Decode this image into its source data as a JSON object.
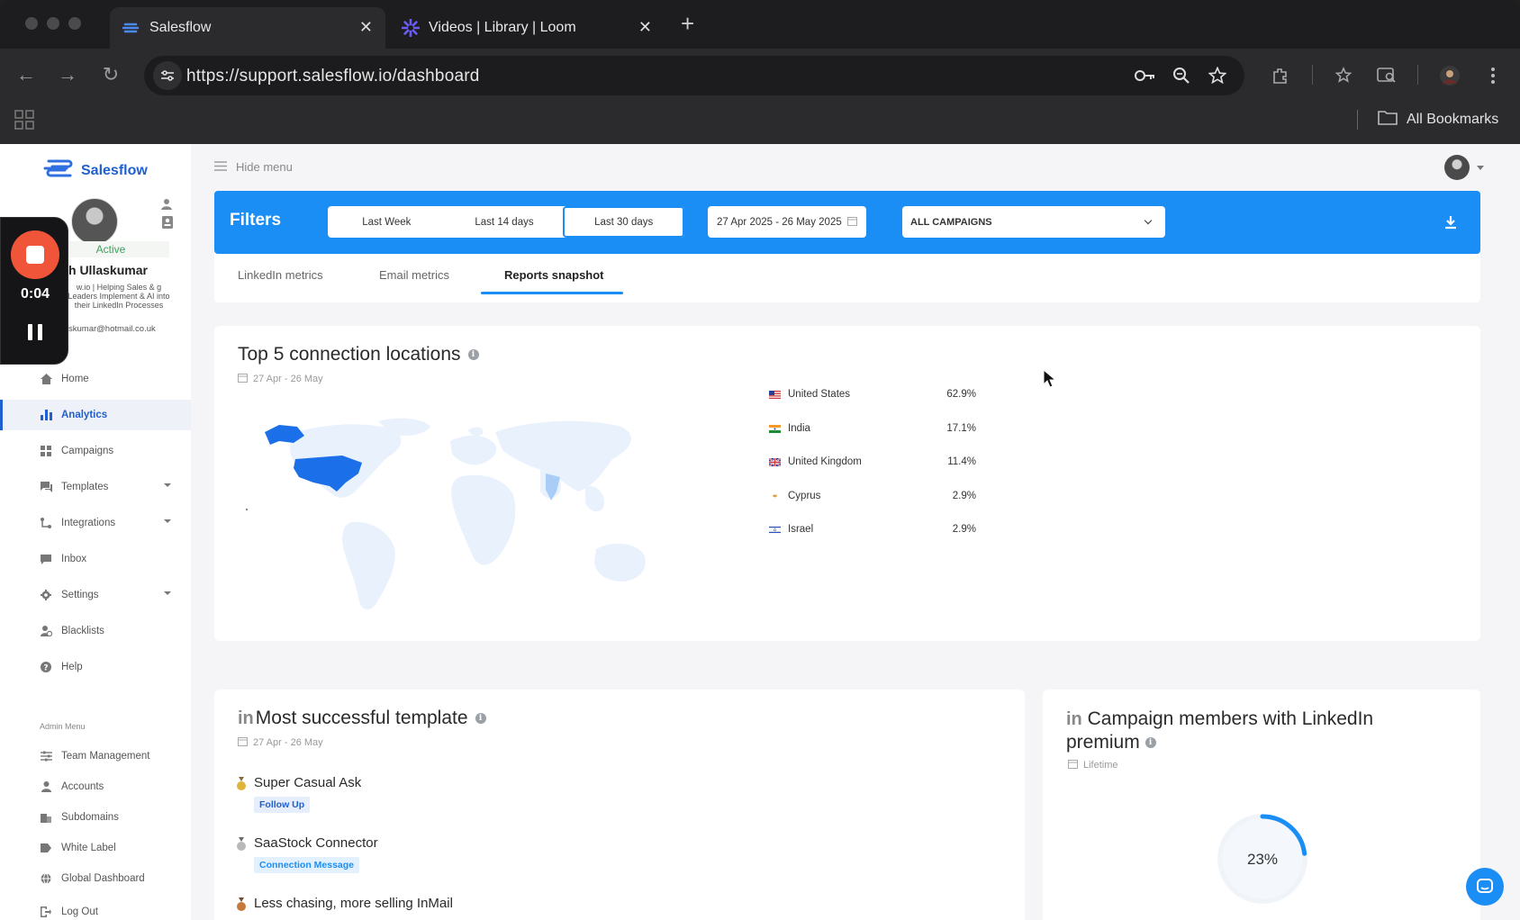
{
  "browser": {
    "tabs": [
      {
        "title": "Salesflow",
        "active": true
      },
      {
        "title": "Videos | Library | Loom",
        "active": false
      }
    ],
    "url": "https://support.salesflow.io/dashboard",
    "bookmarks_label": "All Bookmarks"
  },
  "recorder": {
    "time": "0:04"
  },
  "brand": {
    "name": "Salesflow",
    "accent": "#1b8ef5"
  },
  "profile": {
    "status": "Active",
    "name": "h Ullaskumar",
    "description": "w.io | Helping Sales & g Leaders Implement & AI into their LinkedIn Processes",
    "email": "skumar@hotmail.co.uk"
  },
  "nav": {
    "items": [
      {
        "label": "Home",
        "icon": "home-icon"
      },
      {
        "label": "Analytics",
        "icon": "bar-chart-icon"
      },
      {
        "label": "Campaigns",
        "icon": "grid-icon"
      },
      {
        "label": "Templates",
        "icon": "chat-icon"
      },
      {
        "label": "Integrations",
        "icon": "flow-icon"
      },
      {
        "label": "Inbox",
        "icon": "inbox-icon"
      },
      {
        "label": "Settings",
        "icon": "gear-icon"
      },
      {
        "label": "Blacklists",
        "icon": "user-block-icon"
      },
      {
        "label": "Help",
        "icon": "help-icon"
      }
    ],
    "admin_label": "Admin Menu",
    "admin_items": [
      {
        "label": "Team Management",
        "icon": "sliders-icon"
      },
      {
        "label": "Accounts",
        "icon": "user-icon"
      },
      {
        "label": "Subdomains",
        "icon": "building-icon"
      },
      {
        "label": "White Label",
        "icon": "tag-icon"
      },
      {
        "label": "Global Dashboard",
        "icon": "globe-icon"
      },
      {
        "label": "Log Out",
        "icon": "logout-icon"
      }
    ]
  },
  "topbar": {
    "hide_menu": "Hide menu"
  },
  "filters": {
    "title": "Filters",
    "periods": [
      "Last Week",
      "Last 14 days",
      "Last 30 days"
    ],
    "selected_period": "Last 30 days",
    "date_range": "27 Apr 2025 - 26 May 2025",
    "campaign": "ALL CAMPAIGNS"
  },
  "metric_tabs": [
    "LinkedIn metrics",
    "Email metrics",
    "Reports snapshot"
  ],
  "active_metric_tab": "Reports snapshot",
  "locations": {
    "title": "Top 5 connection locations",
    "period": "27 Apr - 26 May",
    "rows": [
      {
        "country": "United States",
        "percent": "62.9%"
      },
      {
        "country": "India",
        "percent": "17.1%"
      },
      {
        "country": "United Kingdom",
        "percent": "11.4%"
      },
      {
        "country": "Cyprus",
        "percent": "2.9%"
      },
      {
        "country": "Israel",
        "percent": "2.9%"
      }
    ]
  },
  "templates": {
    "title": "Most successful template",
    "period": "27 Apr - 26 May",
    "items": [
      {
        "name": "Super Casual Ask",
        "tag": "Follow Up",
        "medal": "gold"
      },
      {
        "name": "SaaStock Connector",
        "tag": "Connection Message",
        "medal": "silver"
      },
      {
        "name": "Less chasing, more selling InMail",
        "tag": "",
        "medal": "bronze"
      }
    ]
  },
  "premium": {
    "title": "Campaign members with LinkedIn premium",
    "period": "Lifetime",
    "percent_label": "23%",
    "percent_value": 23
  },
  "badge_label": "in"
}
